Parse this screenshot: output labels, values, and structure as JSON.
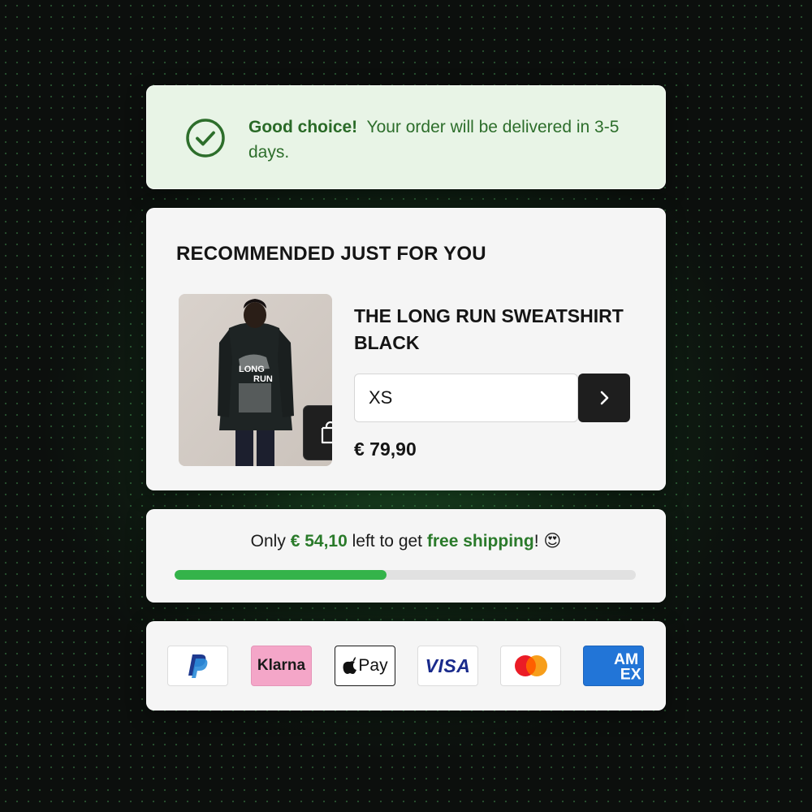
{
  "notice": {
    "headline": "Good choice!",
    "message": "Your order will be delivered in 3-5 days."
  },
  "recommendation": {
    "title": "RECOMMENDED JUST FOR YOU",
    "product_name": "THE LONG RUN SWEATSHIRT BLACK",
    "image_print_line1": "LONG",
    "image_print_line2": "RUN",
    "size_value": "XS",
    "price": "€ 79,90",
    "icons": [
      "add-to-bag-icon",
      "chevron-right-icon"
    ]
  },
  "shipping": {
    "prefix": "Only",
    "amount": "€ 54,10",
    "middle": "left to get",
    "highlight": "free shipping",
    "suffix": "!",
    "emoji": "😍",
    "progress_fraction": 0.46
  },
  "payments": {
    "methods": [
      "paypal-logo",
      "klarna-logo",
      "apple-pay-logo",
      "visa-logo",
      "mastercard-logo",
      "amex-logo"
    ],
    "klarna_label": "Klarna",
    "apple_pay_label": "Pay",
    "visa_label": "VISA",
    "amex_label_1": "AM",
    "amex_label_2": "EX"
  },
  "colors": {
    "accent_green": "#2a7a2a",
    "progress_green": "#34b34a",
    "notice_bg": "#e8f4e6"
  }
}
